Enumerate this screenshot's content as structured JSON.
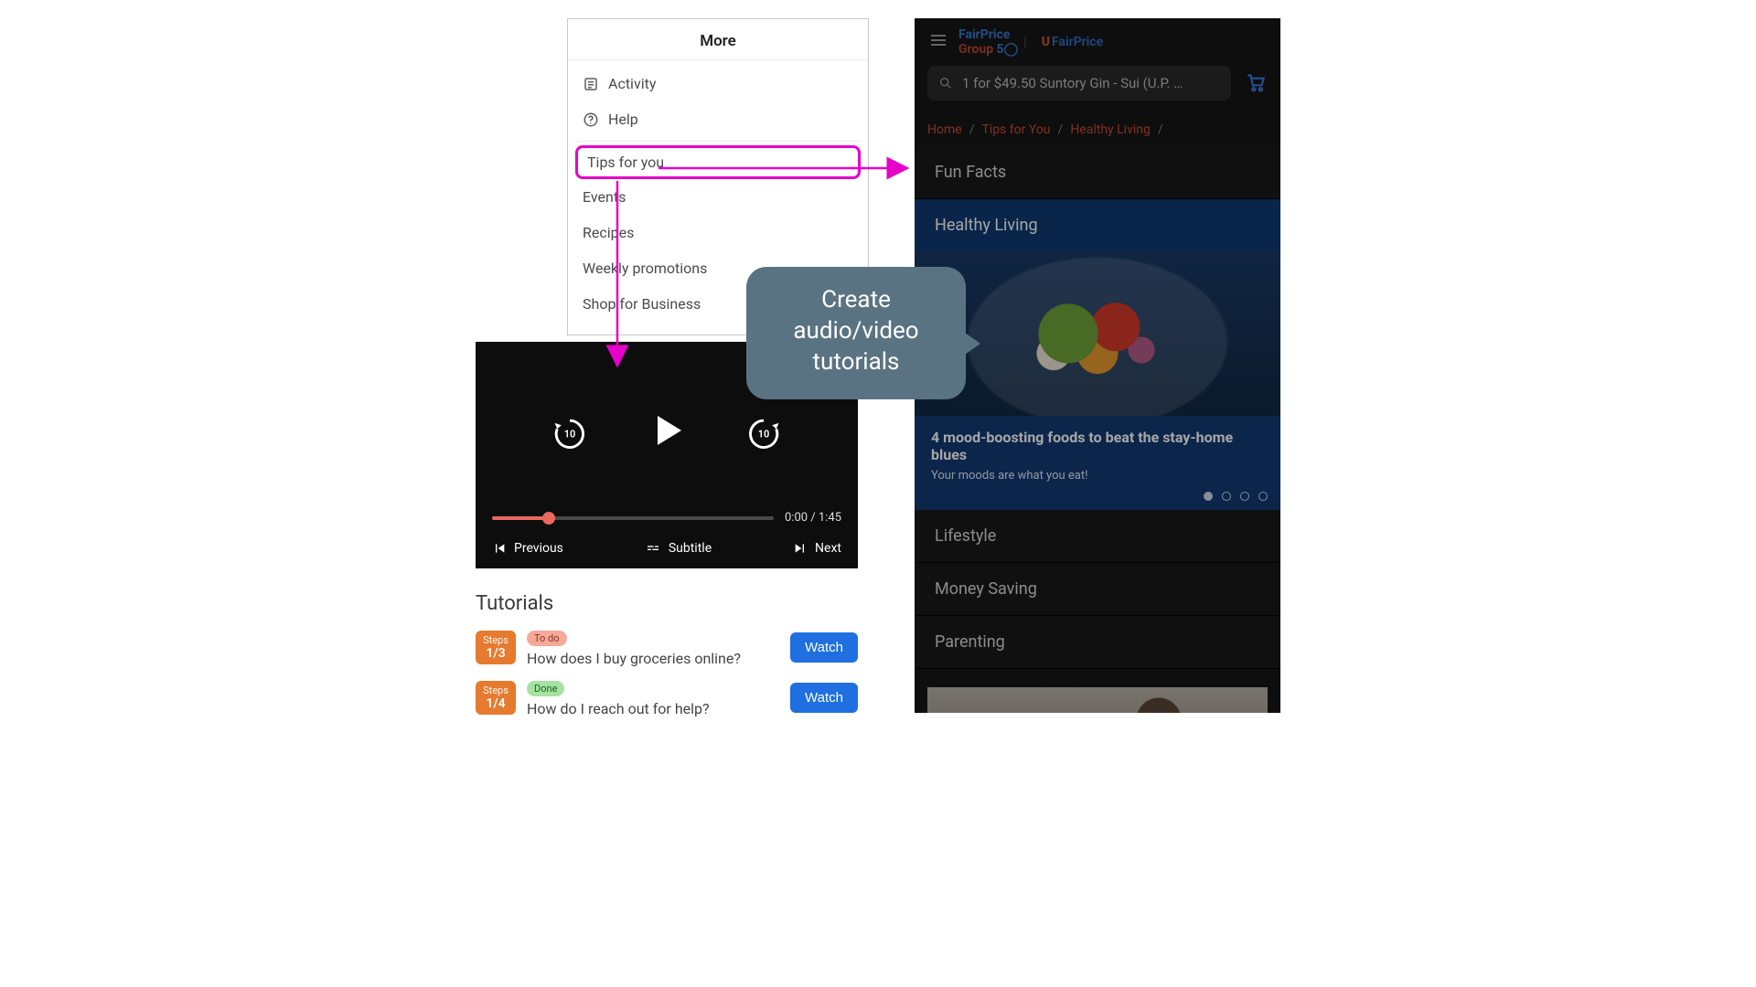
{
  "more": {
    "title": "More",
    "activity": "Activity",
    "help": "Help",
    "tips": "Tips for you",
    "events": "Events",
    "recipes": "Recipes",
    "weekly": "Weekly promotions",
    "business": "Shop for Business"
  },
  "player": {
    "rewind_seconds": "10",
    "forward_seconds": "10",
    "time": "0:00 / 1:45",
    "previous": "Previous",
    "subtitle": "Subtitle",
    "next": "Next"
  },
  "tutorials": {
    "heading": "Tutorials",
    "watch_label": "Watch",
    "items": [
      {
        "step_label": "Steps",
        "step_count": "1/3",
        "status": "To do",
        "status_kind": "todo",
        "question": "How does I buy groceries online?"
      },
      {
        "step_label": "Steps",
        "step_count": "1/4",
        "status": "Done",
        "status_kind": "done",
        "question": "How do I reach out for help?"
      }
    ]
  },
  "fairprice": {
    "brand_group_html": "FairPrice Group 50",
    "brand_fp": "FairPrice",
    "search_text": "1 for $49.50 Suntory Gin - Sui (U.P. …",
    "breadcrumbs": [
      "Home",
      "Tips for You",
      "Healthy Living"
    ],
    "tabs": {
      "fun_facts": "Fun Facts",
      "healthy_living": "Healthy Living",
      "lifestyle": "Lifestyle",
      "money_saving": "Money Saving",
      "parenting": "Parenting"
    },
    "hero": {
      "title": "4 mood-boosting foods to beat the stay-home blues",
      "subtitle": "Your moods are what you eat!",
      "dots_total": 4,
      "dots_active_index": 0
    }
  },
  "callout": {
    "line1": "Create",
    "line2": "audio/video",
    "line3": "tutorials"
  }
}
